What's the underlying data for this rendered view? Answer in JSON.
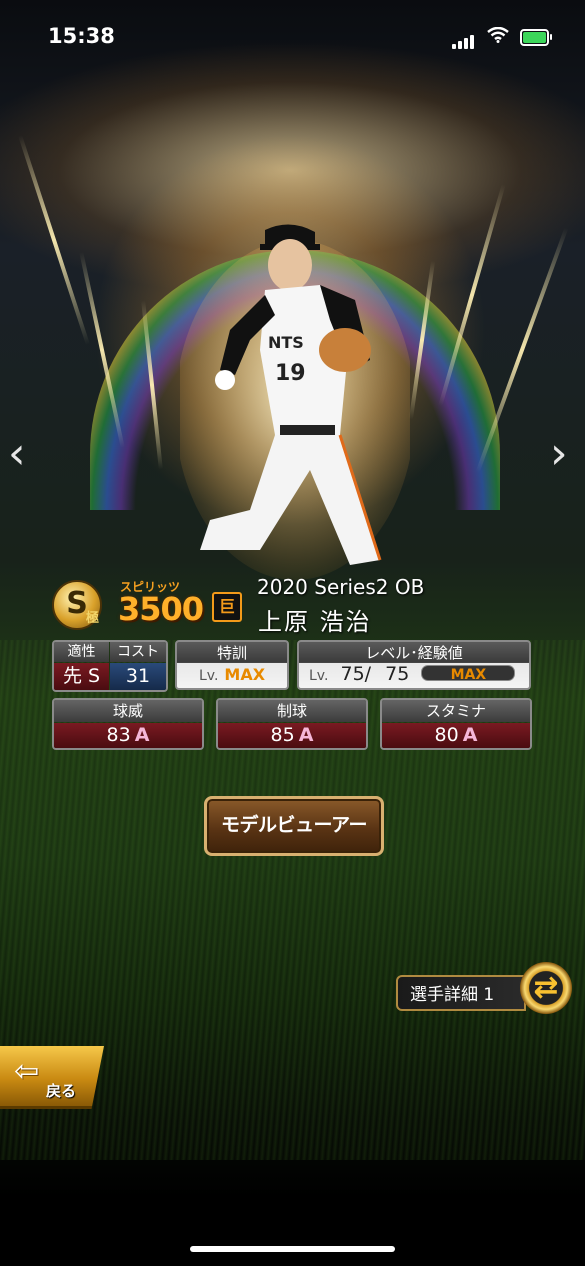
{
  "status_bar": {
    "time": "15:38"
  },
  "card": {
    "rarity": "S",
    "rank_kanji": "極",
    "spirits_label": "スピリッツ",
    "spirits_value": "3500",
    "team_logo": "巨",
    "series": "2020 Series2 OB",
    "player_name": "上原 浩治"
  },
  "aptitude": {
    "label": "適性",
    "value": "先 S"
  },
  "cost": {
    "label": "コスト",
    "value": "31"
  },
  "training": {
    "label": "特訓",
    "lv_prefix": "Lv.",
    "value": "MAX"
  },
  "level": {
    "label": "レベル･経験値",
    "lv_prefix": "Lv.",
    "current": "75/",
    "max": "75",
    "exp_label": "MAX"
  },
  "stats": [
    {
      "label": "球威",
      "value": "83",
      "grade": "A"
    },
    {
      "label": "制球",
      "value": "85",
      "grade": "A"
    },
    {
      "label": "スタミナ",
      "value": "80",
      "grade": "A"
    }
  ],
  "buttons": {
    "model_viewer": "モデルビューアー",
    "player_detail": "選手詳細 1",
    "back": "戻る"
  },
  "colors": {
    "spirits": "#ffb02a",
    "max": "#e88a00",
    "stat_bg": "#7a1a22",
    "grade": "#f5b7d8"
  }
}
